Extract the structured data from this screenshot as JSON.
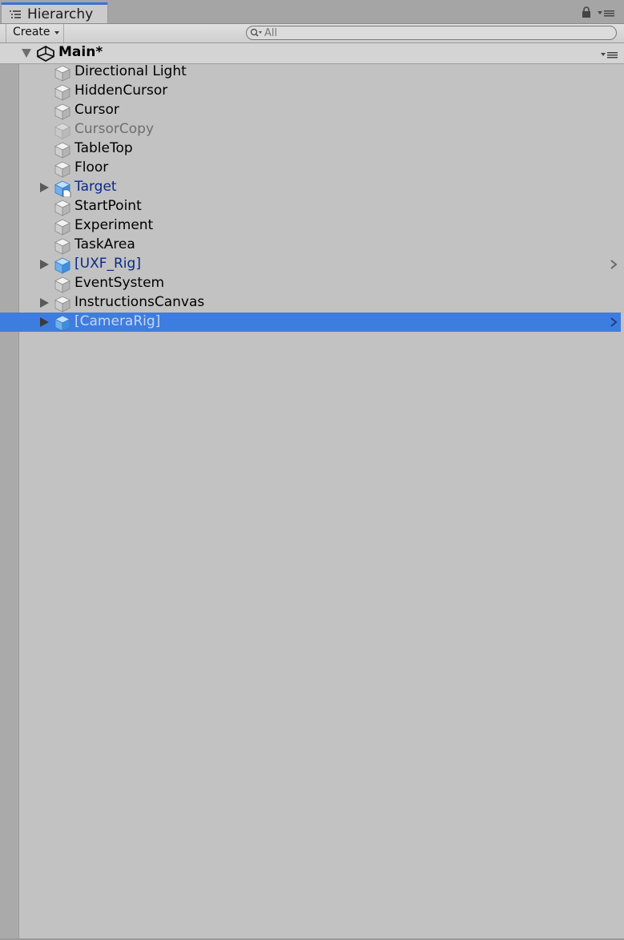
{
  "tab": {
    "label": "Hierarchy"
  },
  "toolbar": {
    "create_label": "Create",
    "search_placeholder": "All"
  },
  "scene": {
    "name": "Main*"
  },
  "items": [
    {
      "label": "Directional Light",
      "kind": "normal",
      "expandable": false,
      "chevron": false
    },
    {
      "label": "HiddenCursor",
      "kind": "normal",
      "expandable": false,
      "chevron": false
    },
    {
      "label": "Cursor",
      "kind": "normal",
      "expandable": false,
      "chevron": false
    },
    {
      "label": "CursorCopy",
      "kind": "inactive",
      "expandable": false,
      "chevron": false
    },
    {
      "label": "TableTop",
      "kind": "normal",
      "expandable": false,
      "chevron": false
    },
    {
      "label": "Floor",
      "kind": "normal",
      "expandable": false,
      "chevron": false
    },
    {
      "label": "Target",
      "kind": "prefab-modified",
      "expandable": true,
      "chevron": false
    },
    {
      "label": "StartPoint",
      "kind": "normal",
      "expandable": false,
      "chevron": false
    },
    {
      "label": "Experiment",
      "kind": "normal",
      "expandable": false,
      "chevron": false
    },
    {
      "label": "TaskArea",
      "kind": "normal",
      "expandable": false,
      "chevron": false
    },
    {
      "label": "[UXF_Rig]",
      "kind": "prefab",
      "expandable": true,
      "chevron": true
    },
    {
      "label": "EventSystem",
      "kind": "normal",
      "expandable": false,
      "chevron": false
    },
    {
      "label": "InstructionsCanvas",
      "kind": "normal",
      "expandable": true,
      "chevron": false
    },
    {
      "label": "[CameraRig]",
      "kind": "prefab",
      "expandable": true,
      "chevron": true,
      "selected": true
    }
  ],
  "colors": {
    "selection": "#3e7de0",
    "prefab_text": "#0a2a8a",
    "background": "#c2c2c2"
  }
}
